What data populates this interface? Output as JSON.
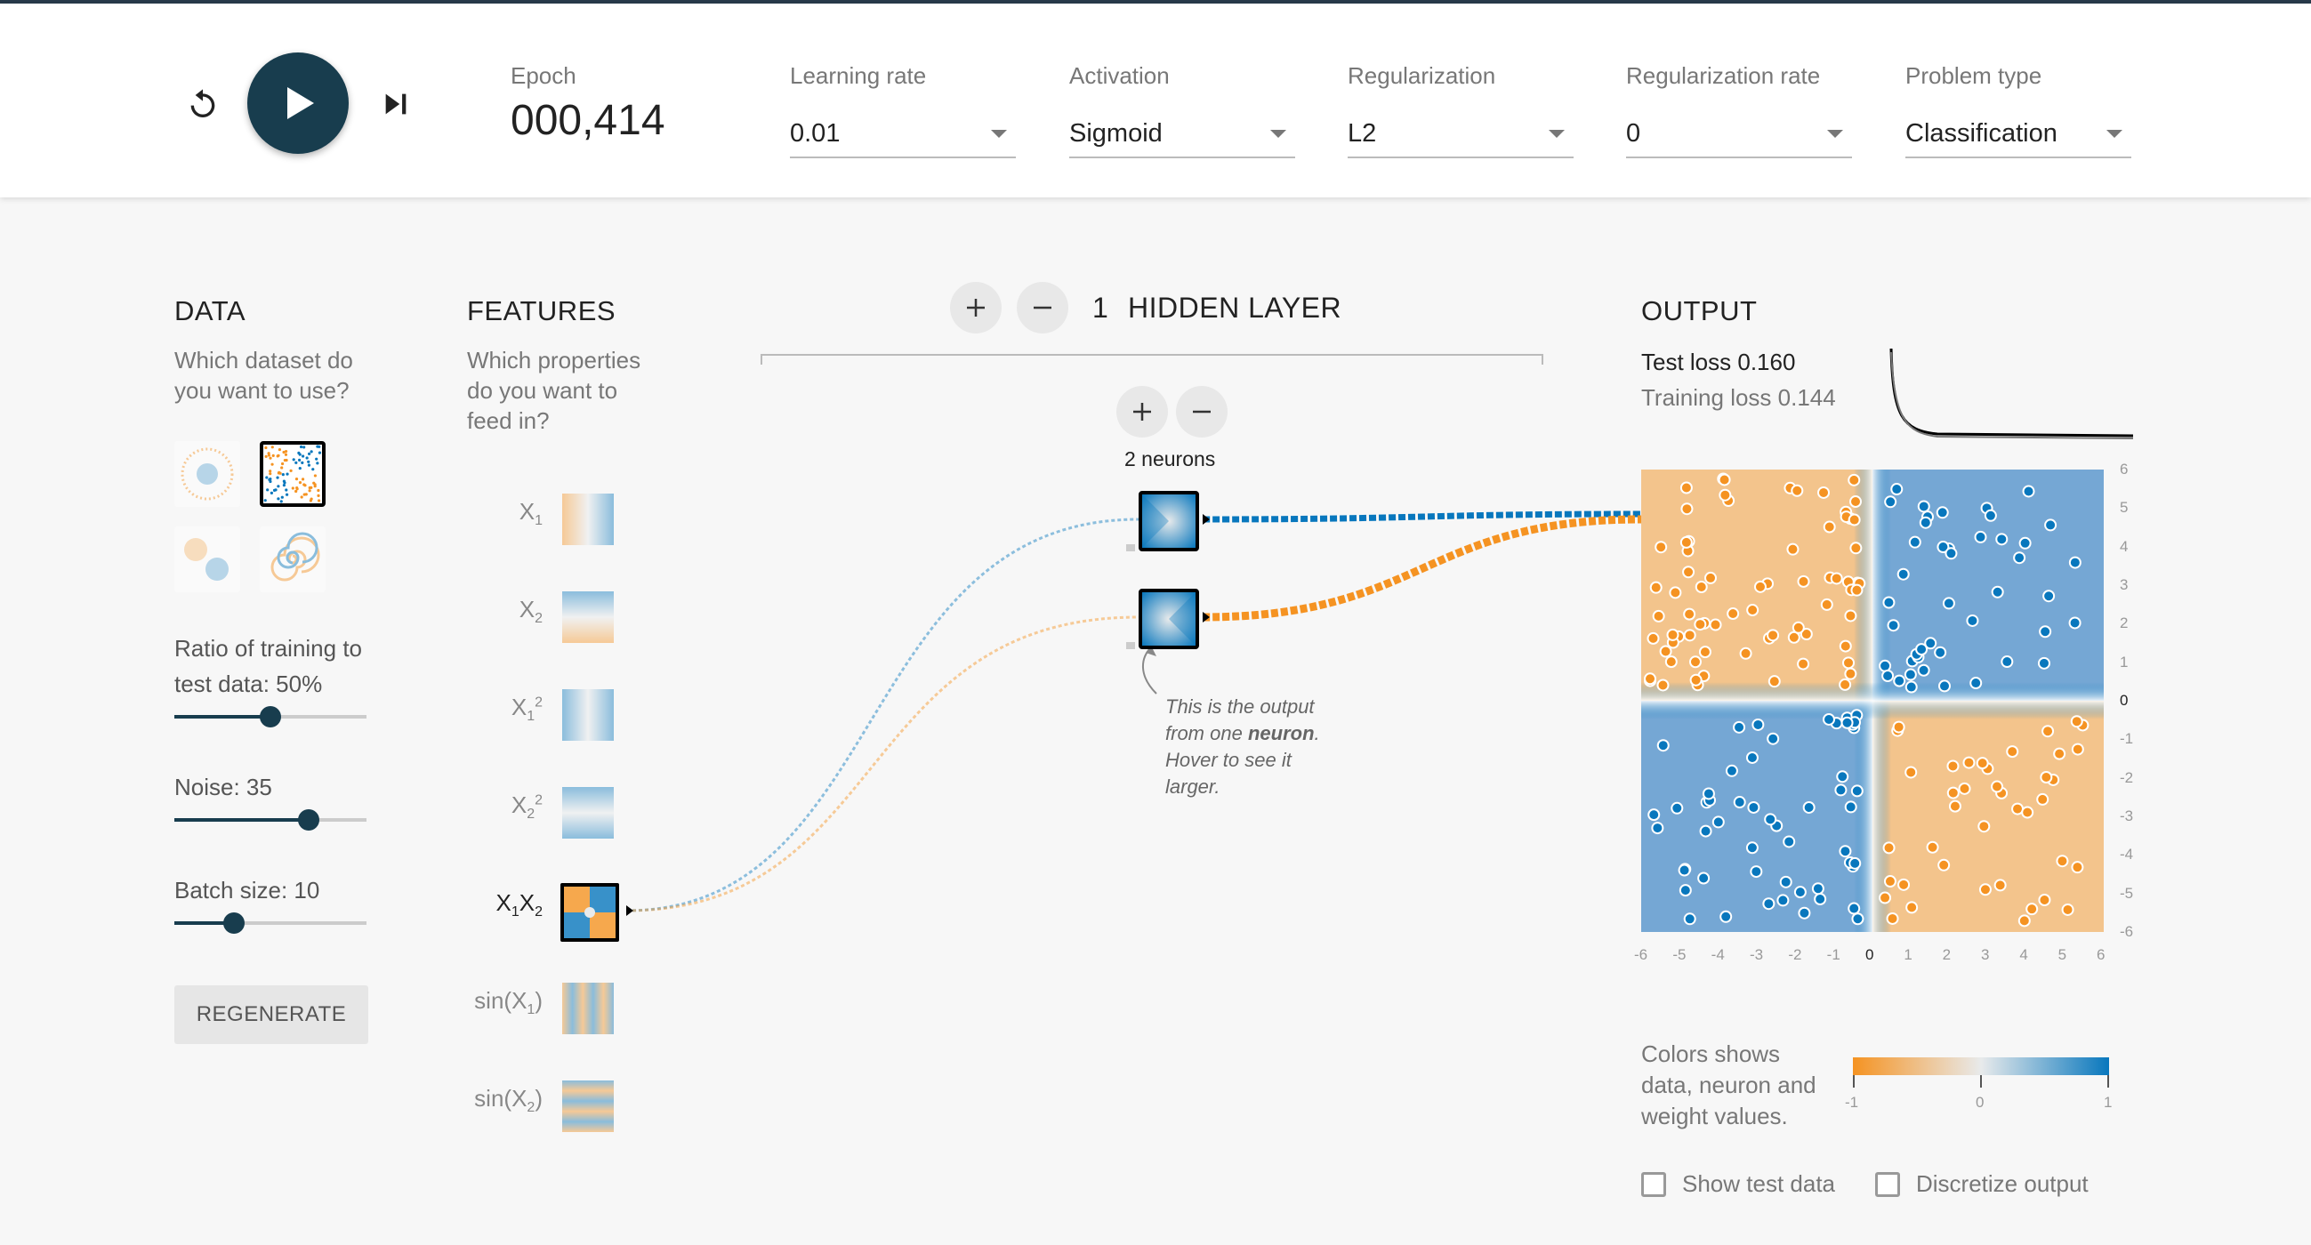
{
  "controls": {
    "epoch_label": "Epoch",
    "epoch_value": "000,414",
    "learning_rate": {
      "label": "Learning rate",
      "value": "0.01"
    },
    "activation": {
      "label": "Activation",
      "value": "Sigmoid"
    },
    "regularization": {
      "label": "Regularization",
      "value": "L2"
    },
    "regularization_rate": {
      "label": "Regularization rate",
      "value": "0"
    },
    "problem_type": {
      "label": "Problem type",
      "value": "Classification"
    }
  },
  "data_panel": {
    "title": "DATA",
    "subtitle_1": "Which dataset do",
    "subtitle_2": "you want to use?",
    "datasets": [
      "circle",
      "xor",
      "gaussian",
      "spiral"
    ],
    "selected_dataset": "xor",
    "ratio_label": "Ratio of training to",
    "ratio_label_2": "test data:  50%",
    "ratio_value": 50,
    "noise_label": "Noise:  35",
    "noise_value": 35,
    "batch_label": "Batch size:  10",
    "batch_value": 10,
    "regenerate_label": "REGENERATE"
  },
  "features_panel": {
    "title": "FEATURES",
    "subtitle_1": "Which properties",
    "subtitle_2": "do you want to",
    "subtitle_3": "feed in?",
    "features": [
      {
        "base": "X",
        "sub": "1",
        "sup": "",
        "active": false
      },
      {
        "base": "X",
        "sub": "2",
        "sup": "",
        "active": false
      },
      {
        "base": "X",
        "sub": "1",
        "sup": "2",
        "active": false
      },
      {
        "base": "X",
        "sub": "2",
        "sup": "2",
        "active": false
      },
      {
        "base": "X1X2",
        "sub": "",
        "sup": "",
        "active": true
      },
      {
        "base": "sin(X1)",
        "sub": "",
        "sup": "",
        "active": false
      },
      {
        "base": "sin(X2)",
        "sub": "",
        "sup": "",
        "active": false
      }
    ]
  },
  "hidden_layers": {
    "count": "1",
    "title": "HIDDEN LAYER",
    "neurons_label": "2 neurons",
    "annotation_1": "This is the output",
    "annotation_2": "from one",
    "annotation_bold": "neuron",
    "annotation_3": "Hover to see it",
    "annotation_4": "larger."
  },
  "output_panel": {
    "title": "OUTPUT",
    "test_loss": "Test loss 0.160",
    "training_loss": "Training loss 0.144",
    "y_ticks": [
      "6",
      "5",
      "4",
      "3",
      "2",
      "1",
      "0",
      "-1",
      "-2",
      "-3",
      "-4",
      "-5",
      "-6"
    ],
    "x_ticks": [
      "-6",
      "-5",
      "-4",
      "-3",
      "-2",
      "-1",
      "0",
      "1",
      "2",
      "3",
      "4",
      "5",
      "6"
    ],
    "legend_text_1": "Colors shows",
    "legend_text_2": "data, neuron and",
    "legend_text_3": "weight values.",
    "legend_ticks": [
      "-1",
      "0",
      "1"
    ],
    "show_test_data": "Show test data",
    "discretize_output": "Discretize output"
  },
  "colors": {
    "orange": "#f59322",
    "blue": "#0877bd",
    "dark": "#183d4e",
    "neutral": "#e8eaeb"
  }
}
